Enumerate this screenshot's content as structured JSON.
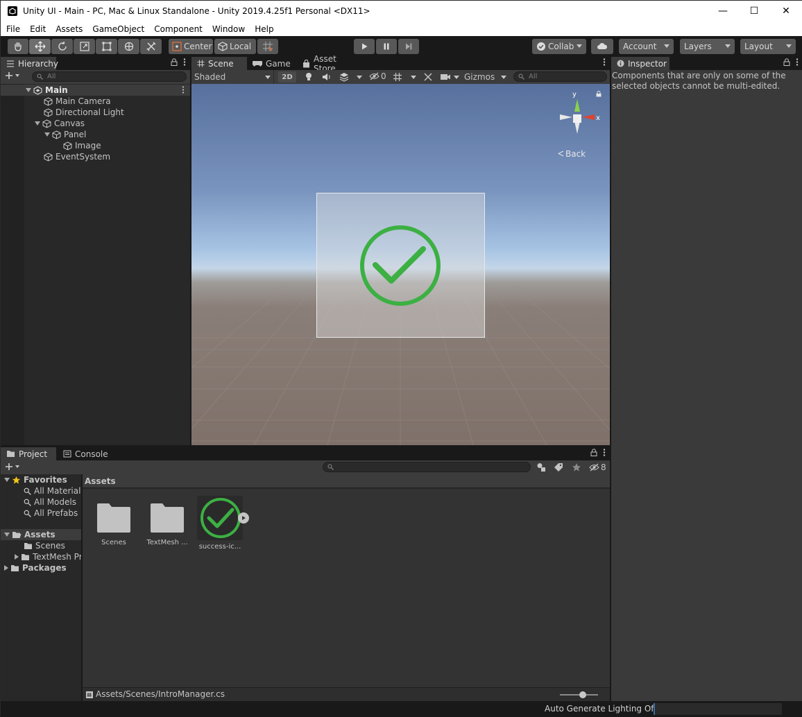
{
  "window": {
    "title": "Unity UI - Main - PC, Mac & Linux Standalone - Unity 2019.4.25f1 Personal <DX11>",
    "minimize": "—",
    "maximize": "☐",
    "close": "✕"
  },
  "menu": [
    "File",
    "Edit",
    "Assets",
    "GameObject",
    "Component",
    "Window",
    "Help"
  ],
  "toolbar": {
    "pivot": "Center",
    "space": "Local",
    "collab": "Collab",
    "account": "Account",
    "layers": "Layers",
    "layout": "Layout"
  },
  "hierarchy": {
    "tab": "Hierarchy",
    "search_placeholder": "All",
    "items": [
      {
        "label": "Main",
        "depth": 0,
        "scene": true
      },
      {
        "label": "Main Camera",
        "depth": 1
      },
      {
        "label": "Directional Light",
        "depth": 1
      },
      {
        "label": "Canvas",
        "depth": 1,
        "expanded": true
      },
      {
        "label": "Panel",
        "depth": 2,
        "expanded": true
      },
      {
        "label": "Image",
        "depth": 3
      },
      {
        "label": "EventSystem",
        "depth": 1
      }
    ]
  },
  "scene_view": {
    "tabs": [
      "Scene",
      "Game",
      "Asset Store"
    ],
    "active_tab": "Scene",
    "shading": "Shaded",
    "mode_2d": "2D",
    "hidden_count": "0",
    "gizmos": "Gizmos",
    "search_placeholder": "All",
    "gizmo_y": "y",
    "gizmo_x": "x",
    "back_label": "Back",
    "check_color": "#3cb043"
  },
  "inspector": {
    "tab": "Inspector",
    "message": "Components that are only on some of the selected objects cannot be multi-edited."
  },
  "project": {
    "tabs": [
      "Project",
      "Console"
    ],
    "active_tab": "Project",
    "hidden_count": "8",
    "favorites_label": "Favorites",
    "favorites": [
      "All Materials",
      "All Models",
      "All Prefabs"
    ],
    "assets_label": "Assets",
    "assets_children": [
      "Scenes",
      "TextMesh Pro"
    ],
    "packages_label": "Packages",
    "breadcrumb": "Assets",
    "grid": [
      {
        "label": "Scenes",
        "kind": "folder"
      },
      {
        "label": "TextMesh ...",
        "kind": "folder"
      },
      {
        "label": "success-ic...",
        "kind": "sprite"
      }
    ],
    "selected_path": "Assets/Scenes/IntroManager.cs",
    "zoom_fraction": 0.6
  },
  "status": {
    "lighting": "Auto Generate Lighting Off"
  }
}
